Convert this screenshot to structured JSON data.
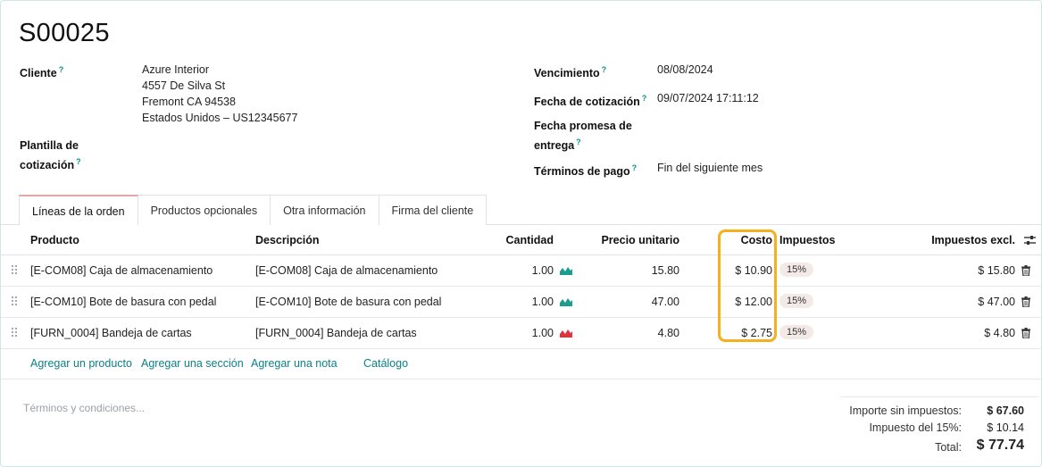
{
  "order": {
    "name": "S00025"
  },
  "left_fields": {
    "cliente_label": "Cliente",
    "cliente_lines": [
      "Azure Interior",
      "4557 De Silva St",
      "Fremont CA 94538",
      "Estados Unidos – US12345677"
    ],
    "plantilla_label_1": "Plantilla de",
    "plantilla_label_2": "cotización"
  },
  "right_fields": {
    "vencimiento_label": "Vencimiento",
    "vencimiento_value": "08/08/2024",
    "fecha_cot_label": "Fecha de cotización",
    "fecha_cot_value": "09/07/2024 17:11:12",
    "fecha_promesa_label_1": "Fecha promesa de",
    "fecha_promesa_label_2": "entrega",
    "terminos_label": "Términos de pago",
    "terminos_value": "Fin del siguiente mes"
  },
  "help_mark": "?",
  "tabs": [
    {
      "label": "Líneas de la orden",
      "active": true
    },
    {
      "label": "Productos opcionales"
    },
    {
      "label": "Otra información"
    },
    {
      "label": "Firma del cliente"
    }
  ],
  "table": {
    "headers": {
      "producto": "Producto",
      "descripcion": "Descripción",
      "cantidad": "Cantidad",
      "precio": "Precio unitario",
      "costo": "Costo",
      "impuestos": "Impuestos",
      "subtotal": "Impuestos excl."
    },
    "rows": [
      {
        "producto": "[E-COM08] Caja de almacenamiento",
        "descripcion": "[E-COM08] Caja de almacenamiento",
        "cantidad": "1.00",
        "precio": "15.80",
        "costo": "$ 10.90",
        "impuesto": "15%",
        "subtotal": "$ 15.80",
        "forecast_color": "#1a9c8f"
      },
      {
        "producto": "[E-COM10] Bote de basura con pedal",
        "descripcion": "[E-COM10] Bote de basura con pedal",
        "cantidad": "1.00",
        "precio": "47.00",
        "costo": "$ 12.00",
        "impuesto": "15%",
        "subtotal": "$ 47.00",
        "forecast_color": "#1a9c8f"
      },
      {
        "producto": "[FURN_0004] Bandeja de cartas",
        "descripcion": "[FURN_0004] Bandeja de cartas",
        "cantidad": "1.00",
        "precio": "4.80",
        "costo": "$ 2.75",
        "impuesto": "15%",
        "subtotal": "$ 4.80",
        "forecast_color": "#d9363e"
      }
    ]
  },
  "actions": {
    "add_product": "Agregar un producto",
    "add_section": "Agregar una sección",
    "add_note": "Agregar una nota",
    "catalog": "Catálogo"
  },
  "terms_placeholder": "Términos y condiciones...",
  "totals": {
    "untaxed_label": "Importe sin impuestos:",
    "untaxed_value": "$ 67.60",
    "tax_label": "Impuesto del 15%:",
    "tax_value": "$ 10.14",
    "total_label": "Total:",
    "total_value": "$ 77.74"
  },
  "colors": {
    "accent": "#0b7f87",
    "highlight": "#f5b01f"
  }
}
